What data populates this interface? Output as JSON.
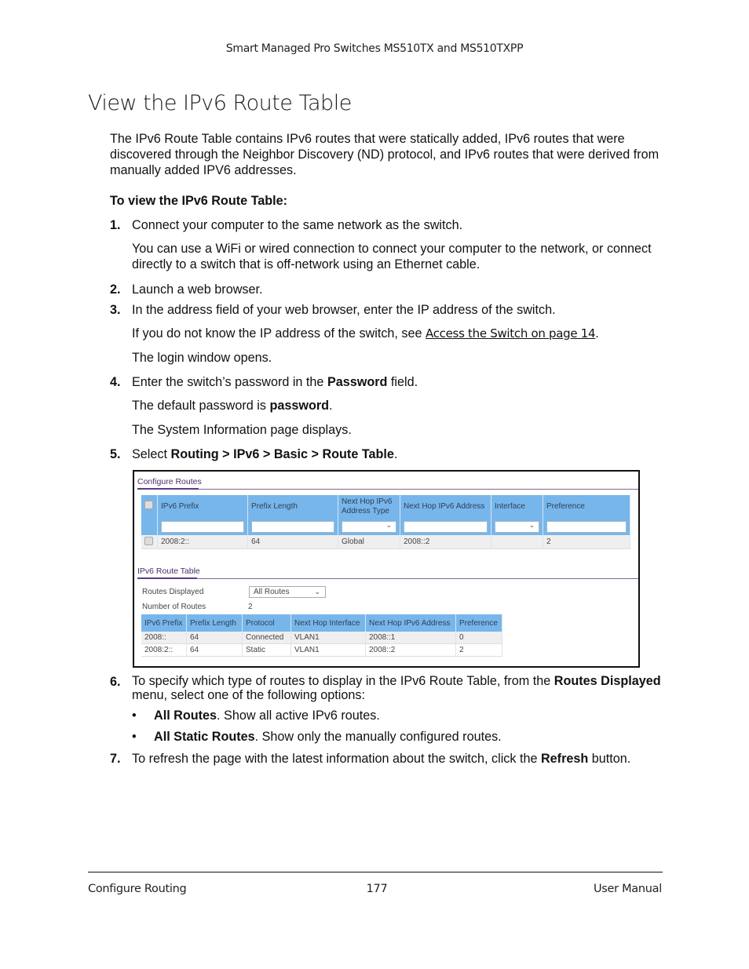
{
  "header": {
    "running_title": "Smart Managed Pro Switches MS510TX and MS510TXPP"
  },
  "page_title": "View the IPv6 Route Table",
  "intro": "The IPv6 Route Table contains IPv6 routes that were statically added, IPv6 routes that were discovered through the Neighbor Discovery (ND) protocol, and IPv6 routes that were derived from manually added IPV6 addresses.",
  "procedure_heading": "To view the IPv6 Route Table:",
  "steps": [
    {
      "num": "1.",
      "text": "Connect your computer to the same network as the switch.",
      "sub": [
        "You can use a WiFi or wired connection to connect your computer to the network, or connect directly to a switch that is off-network using an Ethernet cable."
      ]
    },
    {
      "num": "2.",
      "text": "Launch a web browser."
    },
    {
      "num": "3.",
      "text": "In the address field of your web browser, enter the IP address of the switch.",
      "sub_link": {
        "before": "If you do not know the IP address of the switch, see ",
        "link": "Access the Switch on page 14",
        "after": "."
      },
      "sub2": "The login window opens."
    },
    {
      "num": "4.",
      "pre": "Enter the switch’s password in the ",
      "bold": "Password",
      "post": " field.",
      "sub_a": {
        "pre": "The default password is ",
        "bold": "password",
        "post": "."
      },
      "sub_b": "The System Information page displays."
    },
    {
      "num": "5.",
      "pre": "Select ",
      "bold": "Routing > IPv6 > Basic > Route Table",
      "post": "."
    },
    {
      "num": "6.",
      "pre": "To specify which type of routes to display in the IPv6 Route Table, from the ",
      "bold": "Routes Displayed",
      "post": " menu, select one of the following options:",
      "bullets": [
        {
          "bold": "All Routes",
          "text": ". Show all active IPv6 routes."
        },
        {
          "bold": "All Static Routes",
          "text": ". Show only the manually configured routes."
        }
      ]
    },
    {
      "num": "7.",
      "pre": "To refresh the page with the latest information about the switch, click the ",
      "bold": "Refresh",
      "post": " button."
    }
  ],
  "screenshot": {
    "configure_routes": {
      "title": "Configure Routes",
      "columns": [
        "IPv6 Prefix",
        "Prefix Length",
        "Next Hop IPv6 Address Type",
        "Next Hop IPv6 Address",
        "Interface",
        "Preference"
      ],
      "rows": [
        {
          "ipv6_prefix": "2008:2::",
          "prefix_length": "64",
          "address_type": "Global",
          "next_hop": "2008::2",
          "interface": "",
          "preference": "2"
        }
      ]
    },
    "route_table": {
      "title": "IPv6 Route Table",
      "routes_displayed_label": "Routes Displayed",
      "routes_displayed_value": "All Routes",
      "number_of_routes_label": "Number of Routes",
      "number_of_routes_value": "2",
      "columns": [
        "IPv6 Prefix",
        "Prefix Length",
        "Protocol",
        "Next Hop Interface",
        "Next Hop IPv6 Address",
        "Preference"
      ],
      "rows": [
        [
          "2008::",
          "64",
          "Connected",
          "VLAN1",
          "2008::1",
          "0"
        ],
        [
          "2008:2::",
          "64",
          "Static",
          "VLAN1",
          "2008::2",
          "2"
        ]
      ]
    }
  },
  "footer": {
    "left": "Configure Routing",
    "center": "177",
    "right": "User Manual"
  }
}
